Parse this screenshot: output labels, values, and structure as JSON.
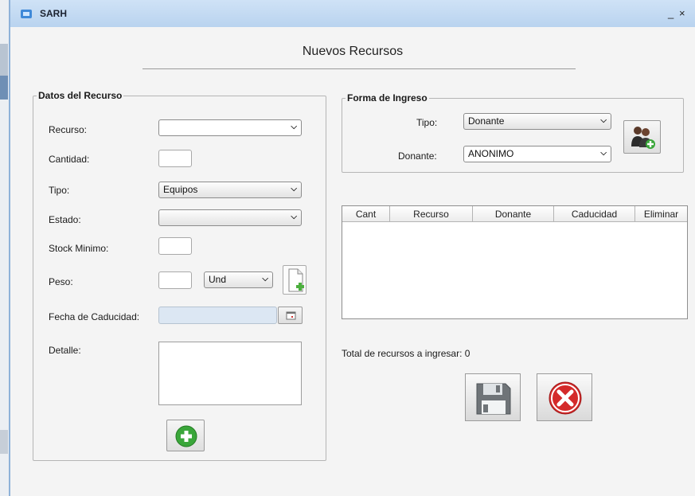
{
  "window": {
    "title": "SARH",
    "minimize_glyph": "_",
    "close_glyph": "×"
  },
  "page": {
    "title": "Nuevos Recursos"
  },
  "datos": {
    "legend": "Datos del Recurso",
    "recurso_label": "Recurso:",
    "recurso_value": "",
    "cantidad_label": "Cantidad:",
    "cantidad_value": "",
    "tipo_label": "Tipo:",
    "tipo_value": "Equipos",
    "estado_label": "Estado:",
    "estado_value": "",
    "stock_label": "Stock Minimo:",
    "stock_value": "",
    "peso_label": "Peso:",
    "peso_value": "",
    "unidad_value": "Und",
    "fecha_label": "Fecha de Caducidad:",
    "fecha_value": "",
    "detalle_label": "Detalle:",
    "detalle_value": ""
  },
  "ingreso": {
    "legend": "Forma de Ingreso",
    "tipo_label": "Tipo:",
    "tipo_value": "Donante",
    "donante_label": "Donante:",
    "donante_value": "ANONIMO"
  },
  "table": {
    "columns": [
      "Cant",
      "Recurso",
      "Donante",
      "Caducidad",
      "Eliminar"
    ],
    "rows": []
  },
  "summary": {
    "total_text": "Total de recursos a ingresar: 0"
  },
  "icons": {
    "dropdown": "chevron-down-icon",
    "add_unit": "new-document-icon",
    "calendar": "calendar-icon",
    "add_resource": "add-icon",
    "add_donor": "add-people-icon",
    "save": "floppy-disk-icon",
    "cancel": "cancel-icon"
  },
  "colors": {
    "title_bar": "#c4daf2",
    "add_green": "#3aa63a",
    "cancel_red": "#d42a2a",
    "disabled_field": "#dce7f3"
  }
}
